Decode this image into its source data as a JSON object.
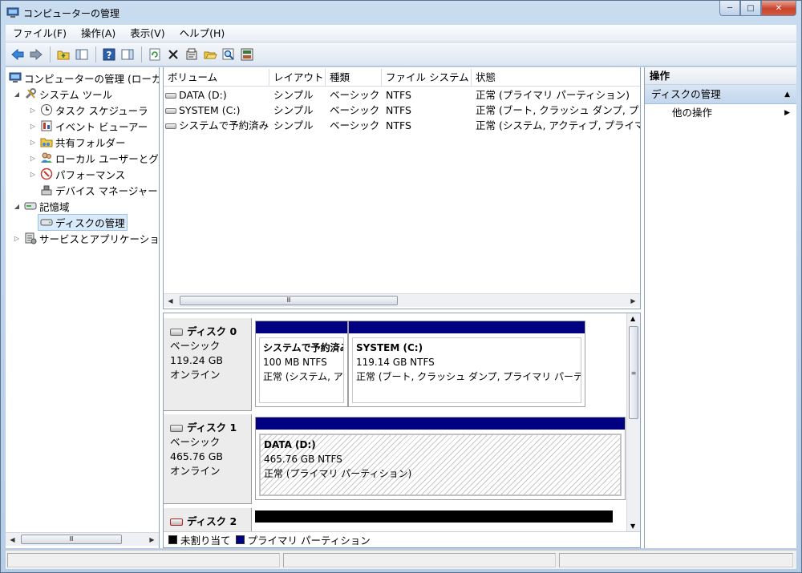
{
  "window": {
    "title": "コンピューターの管理",
    "caption": {
      "minimize": "─",
      "maximize": "□",
      "close": "✕"
    }
  },
  "menu": [
    {
      "label": "ファイル(F)"
    },
    {
      "label": "操作(A)"
    },
    {
      "label": "表示(V)"
    },
    {
      "label": "ヘルプ(H)"
    }
  ],
  "tree": {
    "root": "コンピューターの管理 (ローカ",
    "system_tools": "システム ツール",
    "task_scheduler": "タスク スケジューラ",
    "event_viewer": "イベント ビューアー",
    "shared_folders": "共有フォルダー",
    "local_users": "ローカル ユーザーとグ",
    "performance": "パフォーマンス",
    "device_manager": "デバイス マネージャー",
    "storage": "記憶域",
    "disk_management": "ディスクの管理",
    "services_apps": "サービスとアプリケーショ"
  },
  "volume_list": {
    "columns": [
      "ボリューム",
      "レイアウト",
      "種類",
      "ファイル システム",
      "状態"
    ],
    "rows": [
      [
        "DATA (D:)",
        "シンプル",
        "ベーシック",
        "NTFS",
        "正常 (プライマリ パーティション)"
      ],
      [
        "SYSTEM (C:)",
        "シンプル",
        "ベーシック",
        "NTFS",
        "正常 (ブート, クラッシュ ダンプ, プ"
      ],
      [
        "システムで予約済み",
        "シンプル",
        "ベーシック",
        "NTFS",
        "正常 (システム, アクティブ, プライマ"
      ]
    ]
  },
  "disks": [
    {
      "name": "ディスク 0",
      "type": "ベーシック",
      "size": "119.24 GB",
      "status": "オンライン",
      "partitions": [
        {
          "title": "システムで予約済み",
          "size": "100 MB NTFS",
          "state": "正常 (システム, ア"
        },
        {
          "title": "SYSTEM  (C:)",
          "size": "119.14 GB NTFS",
          "state": "正常 (ブート, クラッシュ ダンプ, プライマリ パーテ"
        }
      ]
    },
    {
      "name": "ディスク 1",
      "type": "ベーシック",
      "size": "465.76 GB",
      "status": "オンライン",
      "partitions": [
        {
          "title": "DATA  (D:)",
          "size": "465.76 GB NTFS",
          "state": "正常 (プライマリ パーティション)"
        }
      ]
    },
    {
      "name": "ディスク 2"
    }
  ],
  "legend": {
    "unallocated": "未割り当て",
    "primary": "プライマリ パーティション",
    "unallocated_color": "#000000",
    "primary_color": "#000080"
  },
  "actions": {
    "header": "操作",
    "section": "ディスクの管理",
    "more": "他の操作"
  },
  "scroll": {
    "thumb_glyph": "Ⅲ",
    "vthumb_glyph": "≡"
  }
}
